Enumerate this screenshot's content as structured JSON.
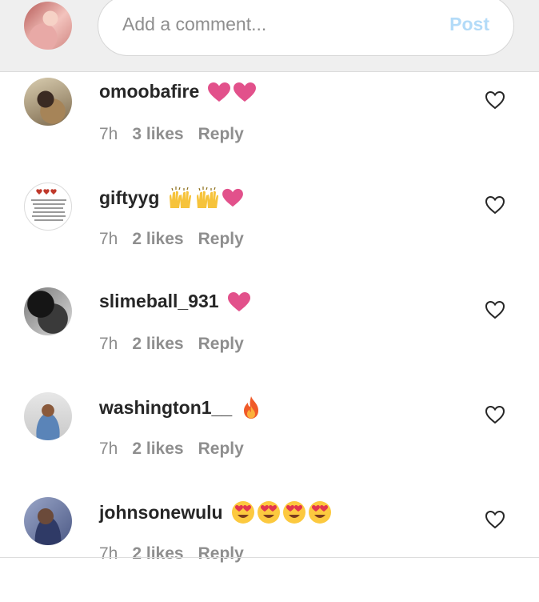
{
  "composer": {
    "placeholder": "Add a comment...",
    "post_label": "Post"
  },
  "comments": [
    {
      "username": "omoobafire",
      "emojis": [
        "heart",
        "heart"
      ],
      "time": "7h",
      "likes": "3 likes",
      "reply": "Reply"
    },
    {
      "username": "giftyyg",
      "emojis": [
        "raised-hands",
        "raised-hands",
        "heart"
      ],
      "time": "7h",
      "likes": "2 likes",
      "reply": "Reply"
    },
    {
      "username": "slimeball_931",
      "emojis": [
        "heart"
      ],
      "time": "7h",
      "likes": "2 likes",
      "reply": "Reply"
    },
    {
      "username": "washington1__",
      "emojis": [
        "fire"
      ],
      "time": "7h",
      "likes": "2 likes",
      "reply": "Reply"
    },
    {
      "username": "johnsonewulu",
      "emojis": [
        "heart-eyes",
        "heart-eyes",
        "heart-eyes",
        "heart-eyes"
      ],
      "time": "7h",
      "likes": "2 likes",
      "reply": "Reply"
    }
  ],
  "colors": {
    "heart": "#e2518b",
    "post": "#b3dbf8",
    "meta": "#8e8e8e",
    "username": "#262626"
  }
}
